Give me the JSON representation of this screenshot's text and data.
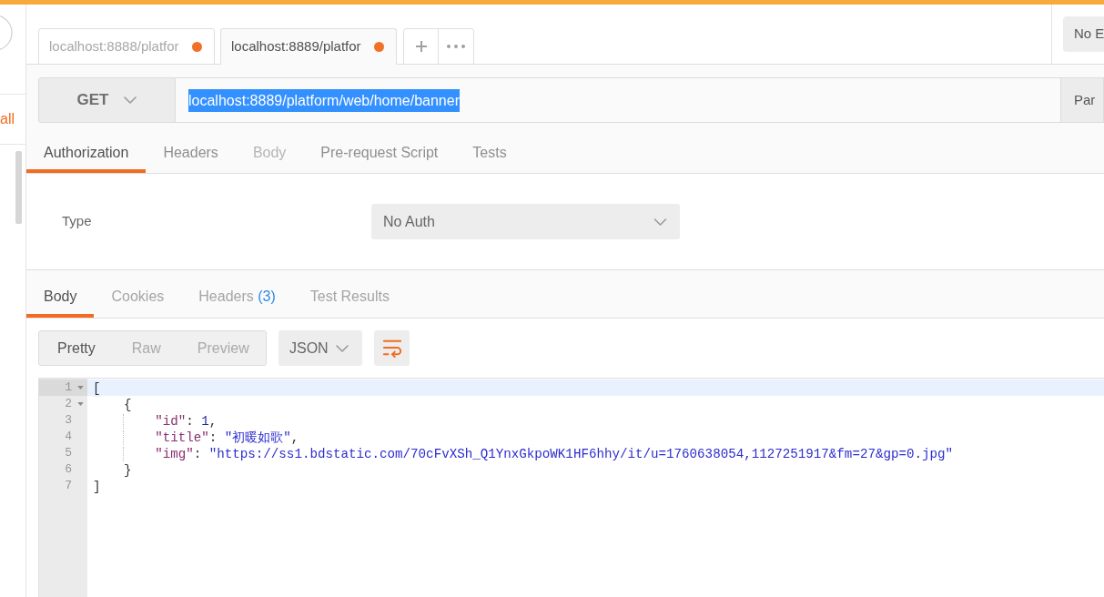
{
  "sidebar": {
    "link": "all"
  },
  "request_tabs": [
    {
      "label": "localhost:8888/platfor",
      "selected": false,
      "unsaved": true
    },
    {
      "label": "localhost:8889/platfor",
      "selected": true,
      "unsaved": true
    }
  ],
  "environment": {
    "value": "No E"
  },
  "request": {
    "method": "GET",
    "url": "localhost:8889/platform/web/home/banner",
    "url_selected": true,
    "params": "Par"
  },
  "request_sections": [
    {
      "label": "Authorization",
      "selected": true,
      "disabled": false
    },
    {
      "label": "Headers",
      "selected": false,
      "disabled": false
    },
    {
      "label": "Body",
      "selected": false,
      "disabled": true
    },
    {
      "label": "Pre-request Script",
      "selected": false,
      "disabled": false
    },
    {
      "label": "Tests",
      "selected": false,
      "disabled": false
    }
  ],
  "auth": {
    "label": "Type",
    "value": "No Auth"
  },
  "response_tabs": [
    {
      "label": "Body",
      "selected": true
    },
    {
      "label": "Cookies",
      "selected": false
    },
    {
      "label": "Headers",
      "count": "(3)",
      "selected": false
    },
    {
      "label": "Test Results",
      "selected": false
    }
  ],
  "view_modes": [
    {
      "label": "Pretty",
      "selected": true
    },
    {
      "label": "Raw",
      "selected": false
    },
    {
      "label": "Preview",
      "selected": false
    }
  ],
  "format": {
    "value": "JSON"
  },
  "editor": {
    "lines": [
      {
        "number": "1",
        "text": "[",
        "foldable": true,
        "active": true
      },
      {
        "number": "2",
        "text": "    {",
        "foldable": true,
        "active": false
      },
      {
        "number": "3",
        "text": "        \"id\": 1,",
        "foldable": false,
        "active": false
      },
      {
        "number": "4",
        "text": "        \"title\": \"初暖如歌\",",
        "foldable": false,
        "active": false
      },
      {
        "number": "5",
        "text": "        \"img\": \"https://ss1.bdstatic.com/70cFvXSh_Q1YnxGkpoWK1HF6hhy/it/u=1760638054,1127251917&fm=27&gp=0.jpg\"",
        "foldable": false,
        "active": false
      },
      {
        "number": "6",
        "text": "    }",
        "foldable": false,
        "active": false
      },
      {
        "number": "7",
        "text": "]",
        "foldable": false,
        "active": false
      }
    ]
  }
}
